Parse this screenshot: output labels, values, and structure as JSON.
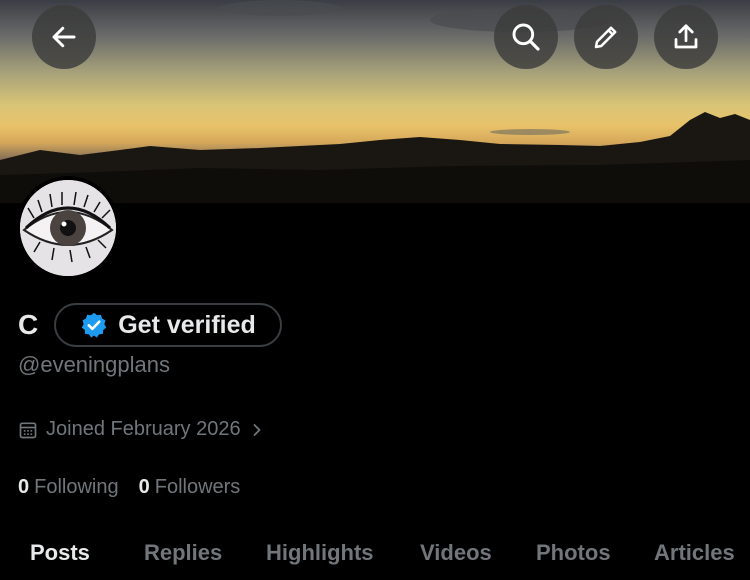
{
  "profile": {
    "display_name": "C",
    "verify_label": "Get verified",
    "handle": "@eveningplans",
    "joined": "Joined February 2026"
  },
  "stats": {
    "following_count": "0",
    "following_label": "Following",
    "followers_count": "0",
    "followers_label": "Followers"
  },
  "tabs": [
    "Posts",
    "Replies",
    "Highlights",
    "Videos",
    "Photos",
    "Articles"
  ],
  "colors": {
    "background": "#000000",
    "text": "#e7e9ea",
    "secondary_text": "#71767b",
    "verified_badge": "#1d9bf0"
  },
  "icons": {
    "back": "arrow-left-icon",
    "search": "search-icon",
    "edit": "pencil-icon",
    "share": "share-icon",
    "verified": "verified-badge-icon",
    "calendar": "calendar-icon",
    "chevron": "chevron-right-icon"
  }
}
